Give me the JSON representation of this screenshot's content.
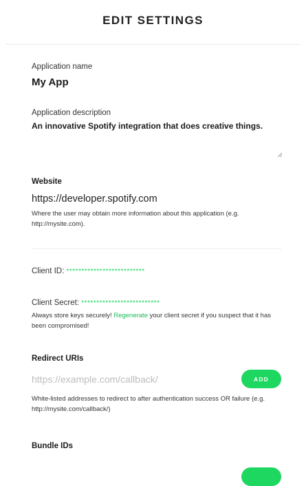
{
  "header": {
    "title": "EDIT SETTINGS"
  },
  "app_name": {
    "label": "Application name",
    "value": "My App"
  },
  "app_description": {
    "label": "Application description",
    "value": "An innovative Spotify integration that does creative things."
  },
  "website": {
    "label": "Website",
    "value": "https://developer.spotify.com",
    "help": "Where the user may obtain more information about this application (e.g. http://mysite.com)."
  },
  "client_id": {
    "label": "Client ID:",
    "value": "**************************"
  },
  "client_secret": {
    "label": "Client Secret:",
    "value": "**************************",
    "help_before": "Always store keys securely! ",
    "help_link": "Regenerate",
    "help_after": " your client secret if you suspect that it has been compromised!"
  },
  "redirect_uris": {
    "label": "Redirect URIs",
    "placeholder": "https://example.com/callback/",
    "add_label": "ADD",
    "help": "White-listed addresses to redirect to after authentication success OR failure (e.g. http://mysite.com/callback/)"
  },
  "bundle_ids": {
    "label": "Bundle IDs"
  },
  "colors": {
    "accent": "#1ed760",
    "link": "#1db954"
  }
}
